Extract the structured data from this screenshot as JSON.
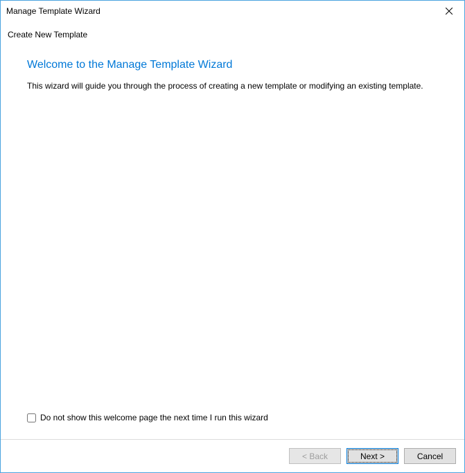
{
  "titlebar": {
    "title": "Manage Template Wizard"
  },
  "header": {
    "subtitle": "Create New Template"
  },
  "content": {
    "heading": "Welcome to the Manage Template Wizard",
    "body": "This wizard will guide you through the process of creating a new template or modifying an existing template."
  },
  "checkbox": {
    "label": "Do not show this welcome page the next time I run this wizard",
    "checked": false
  },
  "buttons": {
    "back": "< Back",
    "next": "Next >",
    "cancel": "Cancel"
  }
}
